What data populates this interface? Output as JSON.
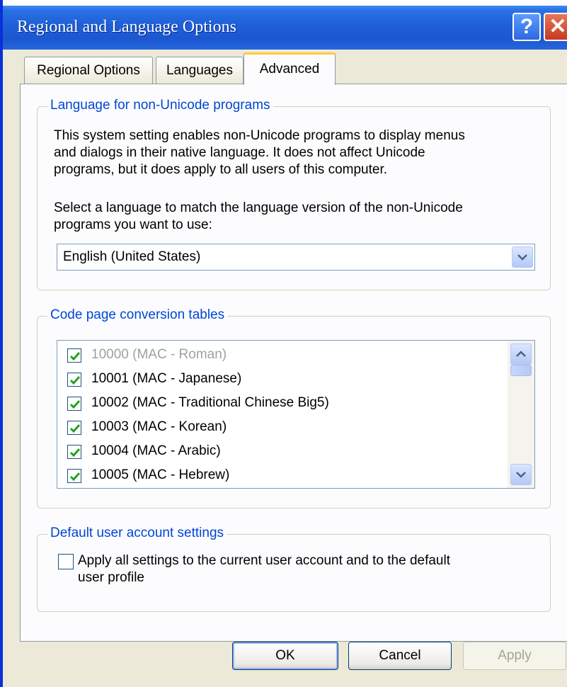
{
  "window": {
    "title": "Regional and Language Options",
    "help_label": "?",
    "close_label": "✕"
  },
  "tabs": [
    {
      "label": "Regional Options"
    },
    {
      "label": "Languages"
    },
    {
      "label": "Advanced"
    }
  ],
  "non_unicode": {
    "title": "Language for non-Unicode programs",
    "description_lines": [
      "This system setting enables non-Unicode programs to display menus",
      "and dialogs in their native language. It does not affect Unicode",
      "programs, but it does apply to all users of this computer."
    ],
    "prompt_lines": [
      "Select a language to match the language version of the non-Unicode",
      "programs you want to use:"
    ],
    "selected_language": "English (United States)"
  },
  "code_pages": {
    "title": "Code page conversion tables",
    "items": [
      {
        "label": "10000 (MAC - Roman)",
        "checked": true,
        "disabled": true
      },
      {
        "label": "10001 (MAC - Japanese)",
        "checked": true,
        "disabled": false
      },
      {
        "label": "10002 (MAC - Traditional Chinese Big5)",
        "checked": true,
        "disabled": false
      },
      {
        "label": "10003 (MAC - Korean)",
        "checked": true,
        "disabled": false
      },
      {
        "label": "10004 (MAC - Arabic)",
        "checked": true,
        "disabled": false
      },
      {
        "label": "10005 (MAC - Hebrew)",
        "checked": true,
        "disabled": false
      }
    ]
  },
  "default_user": {
    "title": "Default user account settings",
    "checkbox_lines": [
      "Apply all settings to the current user account and to the default",
      "user profile"
    ],
    "checked": false
  },
  "buttons": {
    "ok": "OK",
    "cancel": "Cancel",
    "apply": "Apply"
  },
  "colors": {
    "title_bar": "#1e5fd8",
    "group_title": "#0046d5",
    "check_mark": "#21a121"
  }
}
